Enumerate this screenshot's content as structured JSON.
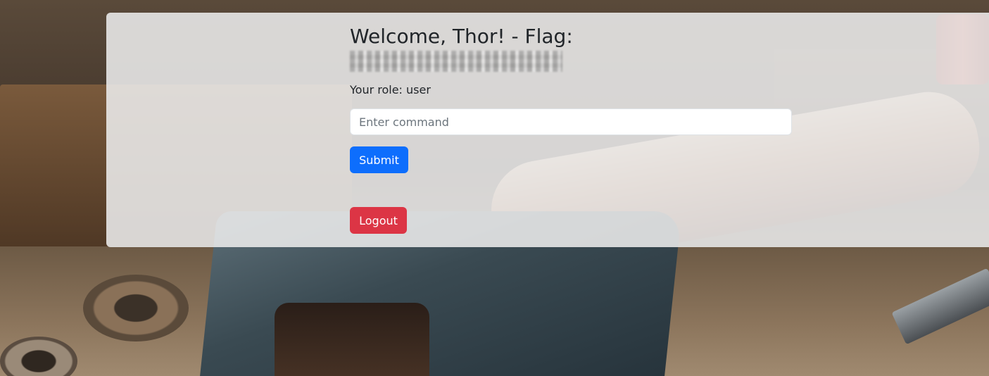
{
  "header": {
    "title": "Welcome, Thor! - Flag:"
  },
  "user": {
    "role_text": "Your role: user"
  },
  "command": {
    "placeholder": "Enter command",
    "value": ""
  },
  "buttons": {
    "submit_label": "Submit",
    "logout_label": "Logout"
  },
  "colors": {
    "submit": "#0d6efd",
    "logout": "#dc3545",
    "panel": "#ececec"
  },
  "icons": {
    "flag": "blurred-redacted-flag-value"
  }
}
